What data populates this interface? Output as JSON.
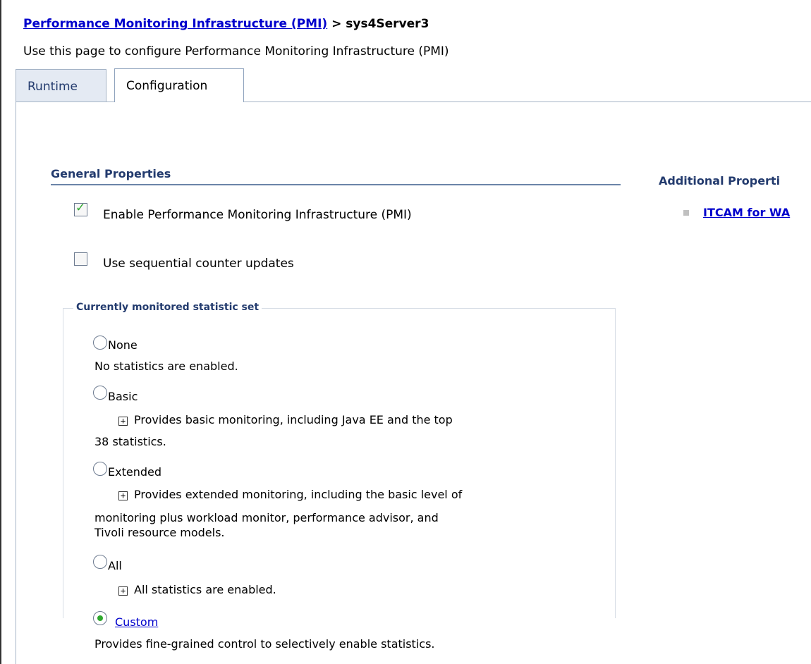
{
  "breadcrumb": {
    "link": "Performance Monitoring Infrastructure (PMI)",
    "separator": " > ",
    "current": "sys4Server3"
  },
  "page_description": "Use this page to configure Performance Monitoring Infrastructure (PMI)",
  "tabs": [
    {
      "label": "Runtime",
      "active": false
    },
    {
      "label": "Configuration",
      "active": true
    }
  ],
  "general_properties": {
    "title": "General Properties",
    "enable_pmi": {
      "label": "Enable Performance Monitoring Infrastructure (PMI)",
      "checked": true
    },
    "sequential_updates": {
      "label": "Use sequential counter updates",
      "checked": false
    }
  },
  "statistic_set": {
    "legend": "Currently monitored statistic set",
    "options": [
      {
        "label": "None",
        "selected": false,
        "desc_lines": [
          "No statistics are enabled."
        ]
      },
      {
        "label": "Basic",
        "selected": false,
        "desc_lines": [
          "Provides basic monitoring, including Java EE and the top",
          "38 statistics."
        ]
      },
      {
        "label": "Extended",
        "selected": false,
        "desc_lines": [
          "Provides extended monitoring, including the basic level of",
          "monitoring plus workload monitor, performance advisor, and",
          "Tivoli resource models."
        ]
      },
      {
        "label": "All",
        "selected": false,
        "desc_lines": [
          "All statistics are enabled."
        ]
      },
      {
        "label": "Custom",
        "selected": true,
        "desc_lines": [
          "Provides fine-grained control to selectively enable statistics."
        ]
      }
    ]
  },
  "additional_properties": {
    "title": "Additional Properti",
    "link": "ITCAM for WA"
  },
  "icons": {
    "checkbox_check": "checkmark-icon",
    "expand": "plus-box-icon",
    "bullet": "square-bullet-icon"
  },
  "colors": {
    "link": "#0000cc",
    "heading": "#233b6e",
    "check": "#2ea82e"
  }
}
